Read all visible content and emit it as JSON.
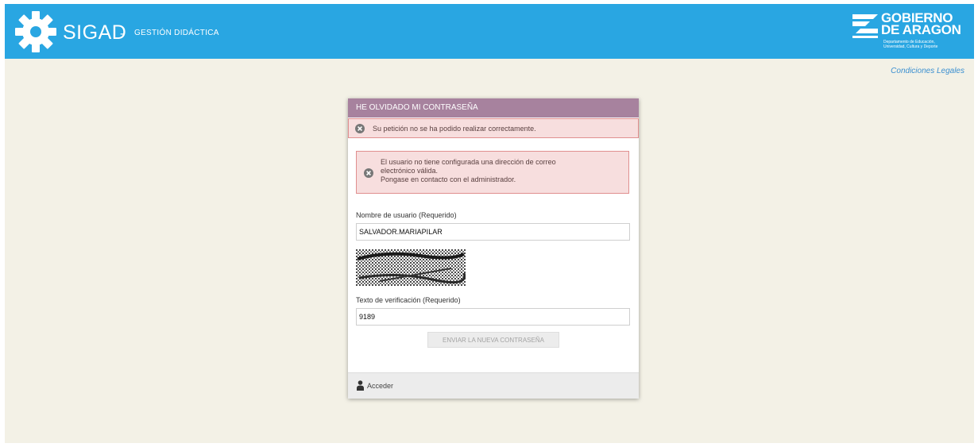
{
  "header": {
    "app_name": "SIGAD",
    "separator": "-",
    "app_subtitle": "GESTIÓN DIDÁCTICA",
    "logo": {
      "line1": "GOBIERNO",
      "line2": "DE ARAGON",
      "line3": "Departamento de Educación,",
      "line4": "Universidad, Cultura y Deporte"
    },
    "colors": {
      "bar": "#29a6e2"
    }
  },
  "legal_link": "Condiciones Legales",
  "panel": {
    "title": "HE OLVIDADO MI CONTRASEÑA",
    "error_banner": "Su petición no se ha podido realizar correctamente.",
    "error_detail": {
      "line1": "El usuario no tiene configurada una dirección de correo",
      "line2": "electrónico válida.",
      "line3": "Pongase en contacto con el administrador."
    },
    "username": {
      "label": "Nombre de usuario (Requerido)",
      "value": "SALVADOR.MARIAPILAR"
    },
    "captcha_text": "9189",
    "verification": {
      "label": "Texto de verificación (Requerido)",
      "value": "9189"
    },
    "submit_label": "ENVIAR LA NUEVA CONTRASEÑA",
    "footer_link": "Acceder",
    "colors": {
      "header": "#a7829e",
      "error_bg": "#f7dede",
      "error_border": "#e08f8f"
    }
  }
}
